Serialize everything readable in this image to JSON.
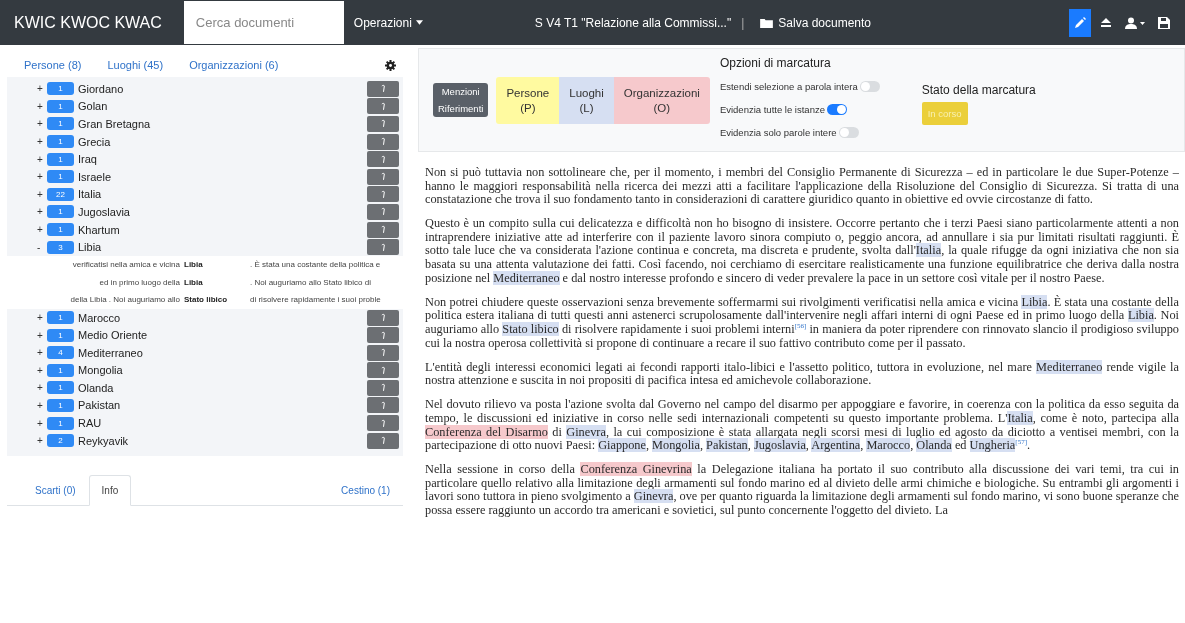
{
  "navbar": {
    "brand": "KWIC KWOC KWAC",
    "search": {
      "placeholder": "Cerca documenti"
    },
    "menu": "Operazioni",
    "document_title": "S V4 T1 \"Relazione alla Commissi...\"",
    "separator": "|",
    "save": "Salva documento",
    "tools": [
      {
        "kind": "edit",
        "selected": true
      },
      {
        "kind": "upload",
        "selected": false
      },
      {
        "kind": "user",
        "selected": false
      },
      {
        "kind": "save",
        "selected": false
      }
    ]
  },
  "entity_tabs": [
    {
      "label": "Persone (8)"
    },
    {
      "label": "Luoghi (45)"
    },
    {
      "label": "Organizzazioni (6)"
    }
  ],
  "tree": [
    {
      "toggle": "+",
      "count": "1",
      "label": "Giordano"
    },
    {
      "toggle": "+",
      "count": "1",
      "label": "Golan"
    },
    {
      "toggle": "+",
      "count": "1",
      "label": "Gran Bretagna"
    },
    {
      "toggle": "+",
      "count": "1",
      "label": "Grecia"
    },
    {
      "toggle": "+",
      "count": "1",
      "label": "Iraq"
    },
    {
      "toggle": "+",
      "count": "1",
      "label": "Israele"
    },
    {
      "toggle": "+",
      "count": "22",
      "label": "Italia"
    },
    {
      "toggle": "+",
      "count": "1",
      "label": "Jugoslavia"
    },
    {
      "toggle": "+",
      "count": "1",
      "label": "Khartum"
    },
    {
      "toggle": "-",
      "count": "3",
      "label": "Libia",
      "children": [
        {
          "left": "verificatisi nella amica e vicina",
          "keyword": "Libia",
          "right": ". È stata una costante della politica e"
        },
        {
          "left": "ed in primo luogo della",
          "keyword": "Libia",
          "right": ". Noi auguriamo allo Stato libico di"
        },
        {
          "left": "della Libia . Noi auguriamo allo",
          "keyword": "Stato libico",
          "right": "di risolvere rapidamente i suoi proble"
        }
      ]
    },
    {
      "toggle": "+",
      "count": "1",
      "label": "Marocco"
    },
    {
      "toggle": "+",
      "count": "1",
      "label": "Medio Oriente"
    },
    {
      "toggle": "+",
      "count": "4",
      "label": "Mediterraneo"
    },
    {
      "toggle": "+",
      "count": "1",
      "label": "Mongolia"
    },
    {
      "toggle": "+",
      "count": "1",
      "label": "Olanda"
    },
    {
      "toggle": "+",
      "count": "1",
      "label": "Pakistan"
    },
    {
      "toggle": "+",
      "count": "1",
      "label": "RAU"
    },
    {
      "toggle": "+",
      "count": "2",
      "label": "Reykyavik"
    }
  ],
  "bottom_tabs": [
    {
      "label": "Scarti (0)",
      "selected": false
    },
    {
      "label": "Info",
      "selected": true
    },
    {
      "label": "Cestino (1)",
      "selected": false
    }
  ],
  "marking": {
    "mode_buttons": [
      "Menzioni",
      "Riferimenti"
    ],
    "categories": [
      {
        "label": "Persone",
        "key": "(P)",
        "color": "#fffaa0"
      },
      {
        "label": "Luoghi",
        "key": "(L)",
        "color": "#d6dff2"
      },
      {
        "label": "Organizzazioni",
        "key": "(O)",
        "color": "#f6c9cc"
      }
    ],
    "options_title": "Opzioni di marcatura",
    "options": [
      {
        "label": "Estendi selezione a parola intera",
        "on": false
      },
      {
        "label": "Evidenzia tutte le istanze",
        "on": true
      },
      {
        "label": "Evidenzia solo parole intere",
        "on": false
      }
    ],
    "status_title": "Stato della marcatura",
    "status": "In corso"
  },
  "document": [
    [
      {
        "kind": "plain",
        "text": "Non si può tuttavia non sottolineare che, per il momento, i membri del Consiglio Permanente di Sicurezza – ed in particolare le due Super-Potenze – hanno le maggiori responsabilità nella ricerca dei mezzi atti a facilitare l'applicazione della Risoluzione del Consiglio di Sicurezza. Si tratta di una constatazione che trova il suo fondamento tanto in considerazioni di carattere giuridico quanto in obiettive ed ovvie circostanze di fatto."
      }
    ],
    [
      {
        "kind": "plain",
        "text": "Questo è un compito sulla cui delicatezza e difficoltà non ho bisogno di insistere. Occorre pertanto che i terzi Paesi siano particolarmente attenti a non intraprendere iniziative atte ad interferire con il paziente lavoro sinora compiuto o, peggio ancora, ad annullare i sia pur limitati risultati raggiunti. È sotto tale luce che va considerata l'azione continua e concreta, ma discreta e prudente, svolta dall'"
      },
      {
        "kind": "place",
        "text": "Italia"
      },
      {
        "kind": "plain",
        "text": ", la quale rifugge da ogni iniziativa che non sia basata su una attenta valutazione dei fatti. Così facendo, noi cerchiamo di esercitare realisticamente una funzione equilibratrice che deriva dalla nostra posizione nel "
      },
      {
        "kind": "place",
        "text": "Mediterraneo"
      },
      {
        "kind": "plain",
        "text": " e dal nostro interesse profondo e sincero di veder prevalere la pace in un settore così vitale per il nostro Paese."
      }
    ],
    [
      {
        "kind": "plain",
        "text": "Non potrei chiudere queste osservazioni senza brevemente soffermarmi sui rivolgimenti verificatisi nella amica e vicina "
      },
      {
        "kind": "place",
        "text": "Libia"
      },
      {
        "kind": "plain",
        "text": ". È stata una costante della politica estera italiana di tutti questi anni astenerci scrupolosamente dall'intervenire negli affari interni di ogni Paese ed in primo luogo della "
      },
      {
        "kind": "place",
        "text": "Libia"
      },
      {
        "kind": "plain",
        "text": ". Noi auguriamo allo "
      },
      {
        "kind": "place",
        "text": "Stato libico"
      },
      {
        "kind": "plain",
        "text": " di risolvere rapidamente i suoi problemi interni"
      },
      {
        "kind": "note",
        "text": "[56]"
      },
      {
        "kind": "plain",
        "text": " in maniera da poter riprendere con rinnovato slancio il prodigioso sviluppo cui la nostra operosa collettività si propone di continuare a recare il suo fattivo contributo come per il passato."
      }
    ],
    [
      {
        "kind": "plain",
        "text": "L'entità degli interessi economici legati ai fecondi rapporti italo-libici e l'assetto politico, tuttora in evoluzione, nel mare "
      },
      {
        "kind": "place",
        "text": "Mediterraneo"
      },
      {
        "kind": "plain",
        "text": " rende vigile la nostra attenzione e suscita in noi propositi di pacifica intesa ed amichevole collaborazione."
      }
    ],
    [
      {
        "kind": "plain",
        "text": "Nel dovuto rilievo va posta l'azione svolta dal Governo nel campo del disarmo per appoggiare e favorire, in coerenza con la politica da esso seguita da tempo, le discussioni ed iniziative in corso nelle sedi internazionali competenti su questo importante problema. L'"
      },
      {
        "kind": "place",
        "text": "Italia"
      },
      {
        "kind": "plain",
        "text": ", come è noto, partecipa alla "
      },
      {
        "kind": "org",
        "text": "Conferenza del Disarmo"
      },
      {
        "kind": "plain",
        "text": " di "
      },
      {
        "kind": "place",
        "text": "Ginevra"
      },
      {
        "kind": "plain",
        "text": ", la cui composizione è stata allargata negli scorsi mesi di luglio ed agosto da diciotto a ventisei membri, con la partecipazione di otto nuovi Paesi: "
      },
      {
        "kind": "place",
        "text": "Giappone"
      },
      {
        "kind": "plain",
        "text": ", "
      },
      {
        "kind": "place",
        "text": "Mongolia"
      },
      {
        "kind": "plain",
        "text": ", "
      },
      {
        "kind": "place",
        "text": "Pakistan"
      },
      {
        "kind": "plain",
        "text": ", "
      },
      {
        "kind": "place",
        "text": "Jugoslavia"
      },
      {
        "kind": "plain",
        "text": ", "
      },
      {
        "kind": "place",
        "text": "Argentina"
      },
      {
        "kind": "plain",
        "text": ", "
      },
      {
        "kind": "place",
        "text": "Marocco"
      },
      {
        "kind": "plain",
        "text": ", "
      },
      {
        "kind": "place",
        "text": "Olanda"
      },
      {
        "kind": "plain",
        "text": " ed "
      },
      {
        "kind": "place",
        "text": "Ungheria"
      },
      {
        "kind": "note",
        "text": "[57]"
      },
      {
        "kind": "plain",
        "text": "."
      }
    ],
    [
      {
        "kind": "plain",
        "text": "Nella sessione in corso della "
      },
      {
        "kind": "org",
        "text": "Conferenza Ginevrina"
      },
      {
        "kind": "plain",
        "text": " la Delegazione italiana ha portato il suo contributo alla discussione dei vari temi, tra cui in particolare quello relativo alla limitazione degli armamenti sul fondo marino ed al divieto delle armi chimiche e biologiche. Su entrambi gli argomenti i lavori sono tuttora in pieno svolgimento a "
      },
      {
        "kind": "place",
        "text": "Ginevra"
      },
      {
        "kind": "plain",
        "text": ", ove per quanto riguarda la limitazione degli armamenti sul fondo marino, vi sono buone speranze che possa essere raggiunto un accordo tra americani e sovietici, sul punto concernente l'oggetto del divieto. La"
      }
    ]
  ]
}
